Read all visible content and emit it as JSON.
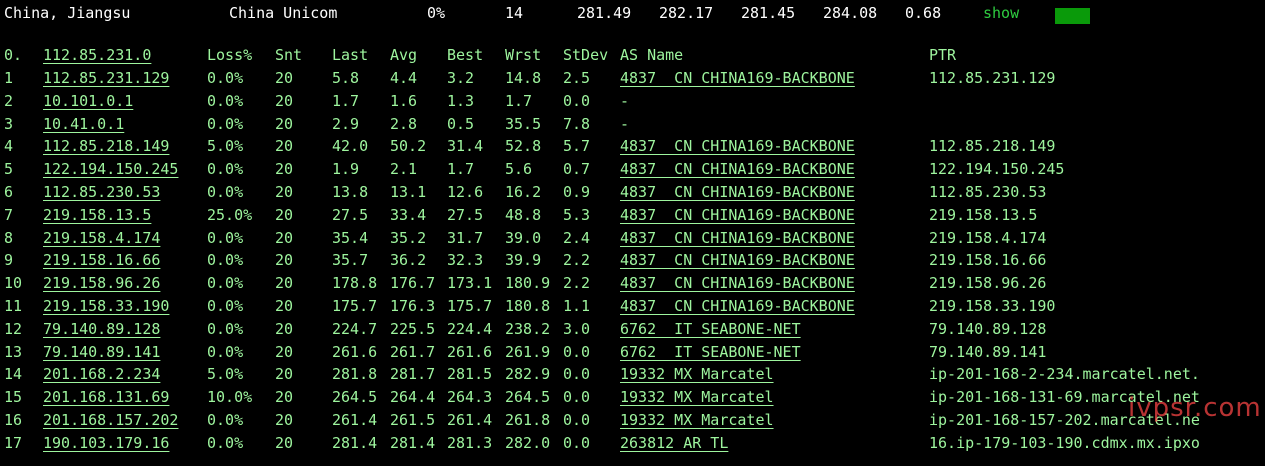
{
  "summary": {
    "location": "China, Jiangsu",
    "isp": "China Unicom",
    "loss": "0%",
    "sent": "14",
    "last": "281.49",
    "avg": "282.17",
    "best": "281.45",
    "worst": "284.08",
    "stdev": "0.68",
    "show_label": "show",
    "indicator_color": "#0a9a0a"
  },
  "header": {
    "hop": "0.",
    "host": "112.85.231.0",
    "loss": "Loss%",
    "snt": "Snt",
    "last": "Last",
    "avg": "Avg",
    "best": "Best",
    "wrst": "Wrst",
    "stdev": "StDev",
    "as_name": "AS Name",
    "ptr": "PTR"
  },
  "hops": [
    {
      "hop": "1",
      "host": "112.85.231.129",
      "loss": "0.0%",
      "snt": "20",
      "last": "5.8",
      "avg": "4.4",
      "best": "3.2",
      "wrst": "14.8",
      "stdev": "2.5",
      "as": "4837  CN CHINA169-BACKBONE",
      "ptr": "112.85.231.129"
    },
    {
      "hop": "2",
      "host": "10.101.0.1",
      "loss": "0.0%",
      "snt": "20",
      "last": "1.7",
      "avg": "1.6",
      "best": "1.3",
      "wrst": "1.7",
      "stdev": "0.0",
      "as": "-",
      "ptr": ""
    },
    {
      "hop": "3",
      "host": "10.41.0.1",
      "loss": "0.0%",
      "snt": "20",
      "last": "2.9",
      "avg": "2.8",
      "best": "0.5",
      "wrst": "35.5",
      "stdev": "7.8",
      "as": "-",
      "ptr": ""
    },
    {
      "hop": "4",
      "host": "112.85.218.149",
      "loss": "5.0%",
      "snt": "20",
      "last": "42.0",
      "avg": "50.2",
      "best": "31.4",
      "wrst": "52.8",
      "stdev": "5.7",
      "as": "4837  CN CHINA169-BACKBONE",
      "ptr": "112.85.218.149"
    },
    {
      "hop": "5",
      "host": "122.194.150.245",
      "loss": "0.0%",
      "snt": "20",
      "last": "1.9",
      "avg": "2.1",
      "best": "1.7",
      "wrst": "5.6",
      "stdev": "0.7",
      "as": "4837  CN CHINA169-BACKBONE",
      "ptr": "122.194.150.245"
    },
    {
      "hop": "6",
      "host": "112.85.230.53",
      "loss": "0.0%",
      "snt": "20",
      "last": "13.8",
      "avg": "13.1",
      "best": "12.6",
      "wrst": "16.2",
      "stdev": "0.9",
      "as": "4837  CN CHINA169-BACKBONE",
      "ptr": "112.85.230.53"
    },
    {
      "hop": "7",
      "host": "219.158.13.5",
      "loss": "25.0%",
      "snt": "20",
      "last": "27.5",
      "avg": "33.4",
      "best": "27.5",
      "wrst": "48.8",
      "stdev": "5.3",
      "as": "4837  CN CHINA169-BACKBONE",
      "ptr": "219.158.13.5"
    },
    {
      "hop": "8",
      "host": "219.158.4.174",
      "loss": "0.0%",
      "snt": "20",
      "last": "35.4",
      "avg": "35.2",
      "best": "31.7",
      "wrst": "39.0",
      "stdev": "2.4",
      "as": "4837  CN CHINA169-BACKBONE",
      "ptr": "219.158.4.174"
    },
    {
      "hop": "9",
      "host": "219.158.16.66",
      "loss": "0.0%",
      "snt": "20",
      "last": "35.7",
      "avg": "36.2",
      "best": "32.3",
      "wrst": "39.9",
      "stdev": "2.2",
      "as": "4837  CN CHINA169-BACKBONE",
      "ptr": "219.158.16.66"
    },
    {
      "hop": "10",
      "host": "219.158.96.26",
      "loss": "0.0%",
      "snt": "20",
      "last": "178.8",
      "avg": "176.7",
      "best": "173.1",
      "wrst": "180.9",
      "stdev": "2.2",
      "as": "4837  CN CHINA169-BACKBONE",
      "ptr": "219.158.96.26"
    },
    {
      "hop": "11",
      "host": "219.158.33.190",
      "loss": "0.0%",
      "snt": "20",
      "last": "175.7",
      "avg": "176.3",
      "best": "175.7",
      "wrst": "180.8",
      "stdev": "1.1",
      "as": "4837  CN CHINA169-BACKBONE",
      "ptr": "219.158.33.190"
    },
    {
      "hop": "12",
      "host": "79.140.89.128",
      "loss": "0.0%",
      "snt": "20",
      "last": "224.7",
      "avg": "225.5",
      "best": "224.4",
      "wrst": "238.2",
      "stdev": "3.0",
      "as": "6762  IT SEABONE-NET",
      "ptr": "79.140.89.128"
    },
    {
      "hop": "13",
      "host": "79.140.89.141",
      "loss": "0.0%",
      "snt": "20",
      "last": "261.6",
      "avg": "261.7",
      "best": "261.6",
      "wrst": "261.9",
      "stdev": "0.0",
      "as": "6762  IT SEABONE-NET",
      "ptr": "79.140.89.141"
    },
    {
      "hop": "14",
      "host": "201.168.2.234",
      "loss": "5.0%",
      "snt": "20",
      "last": "281.8",
      "avg": "281.7",
      "best": "281.5",
      "wrst": "282.9",
      "stdev": "0.0",
      "as": "19332 MX Marcatel",
      "ptr": "ip-201-168-2-234.marcatel.net."
    },
    {
      "hop": "15",
      "host": "201.168.131.69",
      "loss": "10.0%",
      "snt": "20",
      "last": "264.5",
      "avg": "264.4",
      "best": "264.3",
      "wrst": "264.5",
      "stdev": "0.0",
      "as": "19332 MX Marcatel",
      "ptr": "ip-201-168-131-69.marcatel.net"
    },
    {
      "hop": "16",
      "host": "201.168.157.202",
      "loss": "0.0%",
      "snt": "20",
      "last": "261.4",
      "avg": "261.5",
      "best": "261.4",
      "wrst": "261.8",
      "stdev": "0.0",
      "as": "19332 MX Marcatel",
      "ptr": "ip-201-168-157-202.marcatel.ne"
    },
    {
      "hop": "17",
      "host": "190.103.179.16",
      "loss": "0.0%",
      "snt": "20",
      "last": "281.4",
      "avg": "281.4",
      "best": "281.3",
      "wrst": "282.0",
      "stdev": "0.0",
      "as": "263812 AR TL",
      "ptr": "16.ip-179-103-190.cdmx.mx.ipxo"
    }
  ],
  "watermark": "ivpsr.com"
}
